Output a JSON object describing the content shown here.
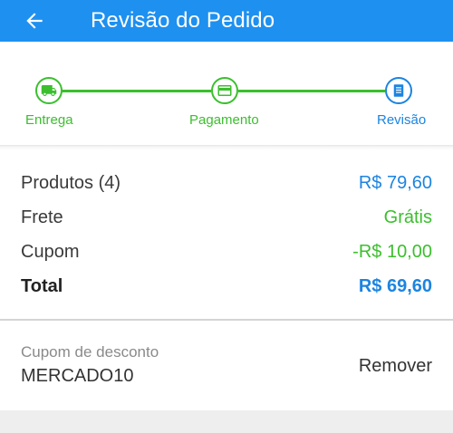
{
  "header": {
    "back_icon": "arrow-left-icon",
    "title": "Revisão do Pedido",
    "color": "#1e90f0"
  },
  "stepper": {
    "steps": [
      {
        "label": "Entrega",
        "icon": "truck-icon",
        "state": "done",
        "color": "#3bbf2e"
      },
      {
        "label": "Pagamento",
        "icon": "credit-card-icon",
        "state": "done",
        "color": "#3bbf2e"
      },
      {
        "label": "Revisão",
        "icon": "receipt-icon",
        "state": "current",
        "color": "#1c84e0"
      }
    ]
  },
  "summary": {
    "products": {
      "label": "Produtos (4)",
      "value": "R$ 79,60"
    },
    "shipping": {
      "label": "Frete",
      "value": "Grátis"
    },
    "coupon": {
      "label": "Cupom",
      "value": "-R$ 10,00"
    },
    "total": {
      "label": "Total",
      "value": "R$ 69,60"
    }
  },
  "discount": {
    "caption": "Cupom de desconto",
    "code": "MERCADO10",
    "remove_label": "Remover"
  }
}
